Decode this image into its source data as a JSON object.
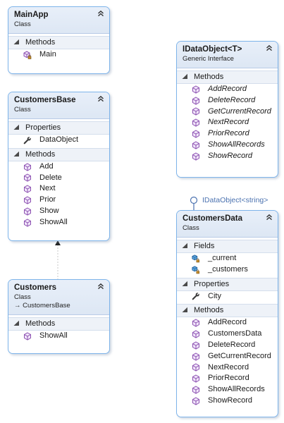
{
  "diagram": {
    "main_app": {
      "title": "MainApp",
      "stereotype": "Class",
      "sections": {
        "methods": "Methods"
      },
      "methods": [
        "Main"
      ]
    },
    "customers_base": {
      "title": "CustomersBase",
      "stereotype": "Class",
      "sections": {
        "properties": "Properties",
        "methods": "Methods"
      },
      "properties": [
        "DataObject"
      ],
      "methods": [
        "Add",
        "Delete",
        "Next",
        "Prior",
        "Show",
        "ShowAll"
      ]
    },
    "customers": {
      "title": "Customers",
      "stereotype": "Class",
      "base": "→ CustomersBase",
      "sections": {
        "methods": "Methods"
      },
      "methods": [
        "ShowAll"
      ]
    },
    "idataobject": {
      "title": "IDataObject<T>",
      "stereotype": "Generic Interface",
      "sections": {
        "methods": "Methods"
      },
      "methods": [
        "AddRecord",
        "DeleteRecord",
        "GetCurrentRecord",
        "NextRecord",
        "PriorRecord",
        "ShowAllRecords",
        "ShowRecord"
      ]
    },
    "customers_data": {
      "title": "CustomersData",
      "stereotype": "Class",
      "implements_label": "IDataObject<string>",
      "sections": {
        "fields": "Fields",
        "properties": "Properties",
        "methods": "Methods"
      },
      "fields": [
        "_current",
        "_customers"
      ],
      "properties": [
        "City"
      ],
      "methods": [
        "AddRecord",
        "CustomersData",
        "DeleteRecord",
        "GetCurrentRecord",
        "NextRecord",
        "PriorRecord",
        "ShowAllRecords",
        "ShowRecord"
      ]
    }
  },
  "icons": {
    "method": "method-cube-icon",
    "private_method": "private-method-icon",
    "property": "wrench-icon",
    "field": "field-icon",
    "collapse": "collapse-chevron-icon"
  },
  "colors": {
    "border": "#7eb4ea",
    "header_bg": "#e3ebf6",
    "method_icon": "#8b4fb0",
    "field_icon": "#1f77b4",
    "connector": "#4b72b0"
  }
}
